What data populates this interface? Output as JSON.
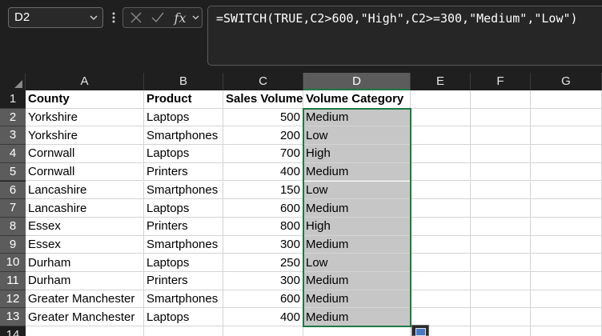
{
  "name_box": {
    "value": "D2"
  },
  "formula_bar": {
    "cancel_icon": "x-icon",
    "enter_icon": "check-icon",
    "function_label": "fx",
    "formula": "=SWITCH(TRUE,C2>600,\"High\",C2>=300,\"Medium\",\"Low\")"
  },
  "columns": [
    "A",
    "B",
    "C",
    "D",
    "E",
    "F",
    "G"
  ],
  "rows": [
    "1",
    "2",
    "3",
    "4",
    "5",
    "6",
    "7",
    "8",
    "9",
    "10",
    "11",
    "12",
    "13",
    "14"
  ],
  "selected_column": "D",
  "selected_range": "D2:D13",
  "headers": [
    "County",
    "Product",
    "Sales Volume",
    "Volume Category"
  ],
  "data": [
    [
      "Yorkshire",
      "Laptops",
      "500",
      "Medium"
    ],
    [
      "Yorkshire",
      "Smartphones",
      "200",
      "Low"
    ],
    [
      "Cornwall",
      "Laptops",
      "700",
      "High"
    ],
    [
      "Cornwall",
      "Printers",
      "400",
      "Medium"
    ],
    [
      "Lancashire",
      "Smartphones",
      "150",
      "Low"
    ],
    [
      "Lancashire",
      "Laptops",
      "600",
      "Medium"
    ],
    [
      "Essex",
      "Printers",
      "800",
      "High"
    ],
    [
      "Essex",
      "Smartphones",
      "300",
      "Medium"
    ],
    [
      "Durham",
      "Laptops",
      "250",
      "Low"
    ],
    [
      "Durham",
      "Printers",
      "300",
      "Medium"
    ],
    [
      "Greater Manchester",
      "Smartphones",
      "600",
      "Medium"
    ],
    [
      "Greater Manchester",
      "Laptops",
      "400",
      "Medium"
    ]
  ],
  "colors": {
    "selection_border": "#1e7a45",
    "selection_fill": "#c6c6c6",
    "header_selected": "#5c5c5c"
  }
}
